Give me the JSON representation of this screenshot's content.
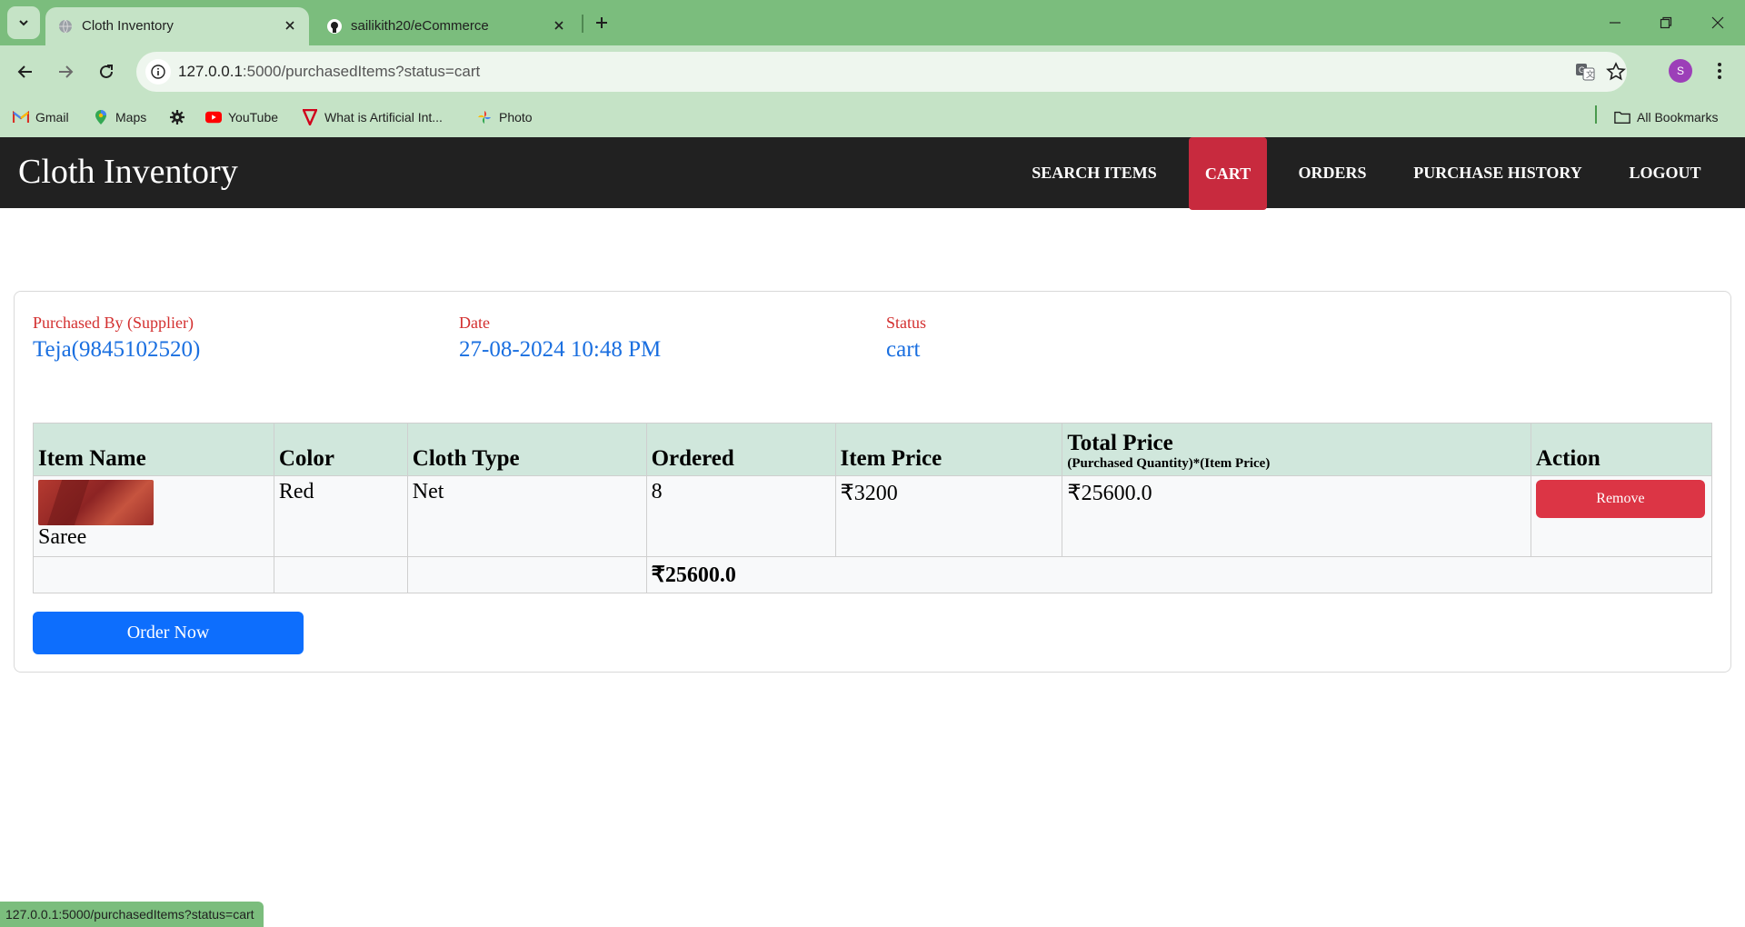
{
  "browser": {
    "tabs": [
      {
        "title": "Cloth Inventory",
        "active": true
      },
      {
        "title": "sailikith20/eCommerce",
        "active": false
      }
    ],
    "url": {
      "host": "127.0.0.1",
      "path": ":5000/purchasedItems?status=cart"
    },
    "profile_initial": "S",
    "bookmarks": [
      {
        "label": "Gmail",
        "icon": "gmail-icon"
      },
      {
        "label": "Maps",
        "icon": "maps-icon"
      },
      {
        "label": "",
        "icon": "gear-icon"
      },
      {
        "label": "YouTube",
        "icon": "youtube-icon"
      },
      {
        "label": "What is Artificial Int...",
        "icon": "bookmark-v-icon"
      },
      {
        "label": "Photo",
        "icon": "photos-icon"
      }
    ],
    "all_bookmarks": "All Bookmarks",
    "status_url": "127.0.0.1:5000/purchasedItems?status=cart",
    "colors": {
      "frame": "#7bbd7d",
      "toolbar": "#c5e3c6"
    }
  },
  "app": {
    "brand": "Cloth Inventory",
    "nav": [
      {
        "label": "SEARCH ITEMS",
        "active": false
      },
      {
        "label": "CART",
        "active": true
      },
      {
        "label": "ORDERS",
        "active": false
      },
      {
        "label": "PURCHASE HISTORY",
        "active": false
      },
      {
        "label": "LOGOUT",
        "active": false
      }
    ],
    "colors": {
      "navbar": "#212121",
      "active_nav": "#c82a3e",
      "label": "#d32f2f",
      "value": "#1a6fe0",
      "primary": "#0d6efd",
      "danger": "#dc3545"
    }
  },
  "order": {
    "purchased_by_label": "Purchased By (Supplier)",
    "purchased_by_value": "Teja(9845102520)",
    "date_label": "Date",
    "date_value": "27-08-2024 10:48 PM",
    "status_label": "Status",
    "status_value": "cart"
  },
  "table": {
    "headers": {
      "item_name": "Item Name",
      "color": "Color",
      "cloth_type": "Cloth Type",
      "ordered": "Ordered",
      "item_price": "Item Price",
      "total_price": "Total Price",
      "total_price_sub": "(Purchased Quantity)*(Item Price)",
      "action": "Action"
    },
    "rows": [
      {
        "item_name": "Saree",
        "color": "Red",
        "cloth_type": "Net",
        "ordered": "8",
        "item_price": "₹3200",
        "total_price": "₹25600.0",
        "action_label": "Remove"
      }
    ],
    "grand_total": "₹25600.0"
  },
  "order_button": "Order Now"
}
